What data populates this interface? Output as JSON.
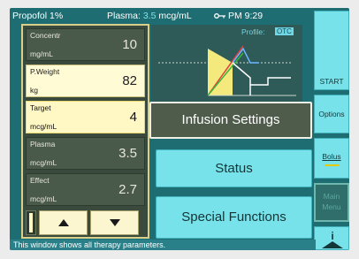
{
  "topbar": {
    "drug": "Propofol 1%",
    "plasma_label": "Plasma:",
    "plasma_value": "3.5",
    "plasma_unit": "mcg/mL",
    "time": "PM 9:29"
  },
  "params": [
    {
      "label": "Concentr",
      "unit": "mg/mL",
      "value": "10"
    },
    {
      "label": "P.Weight",
      "unit": "kg",
      "value": "82"
    },
    {
      "label": "Target",
      "unit": "mcg/mL",
      "value": "4"
    },
    {
      "label": "Plasma",
      "unit": "mcg/mL",
      "value": "3.5"
    },
    {
      "label": "Effect",
      "unit": "mcg/mL",
      "value": "2.7"
    }
  ],
  "graph": {
    "profile_label": "Profile:",
    "profile_badge": "OTC"
  },
  "menu": {
    "infusion_settings": "Infusion Settings",
    "status": "Status",
    "special_functions": "Special Functions"
  },
  "side": {
    "start": "START",
    "options": "Options",
    "bolus": "Bolus",
    "main_menu_line1": "Main",
    "main_menu_line2": "Menu",
    "info": "i"
  },
  "status_message": "This window shows all therapy parameters.",
  "colors": {
    "screen_bg": "#1d6d72",
    "accent_cyan": "#78e2ea",
    "param_dark": "#4a5a4a",
    "param_light": "#fffbd4",
    "bolus_bar": "#e6c900"
  }
}
